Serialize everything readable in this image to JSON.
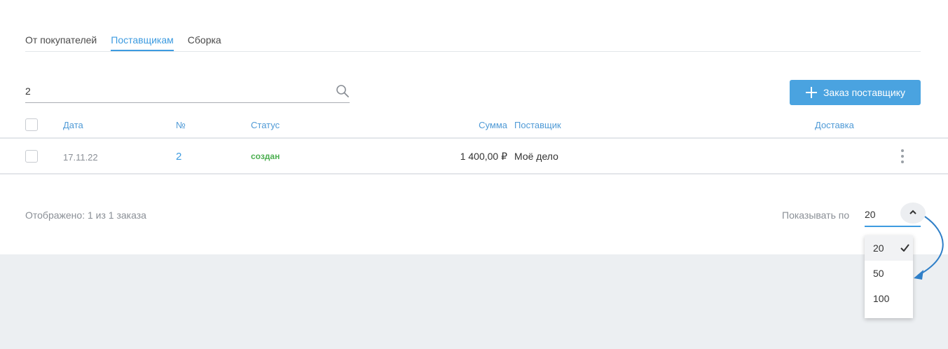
{
  "tabs": [
    {
      "label": "От покупателей",
      "active": false
    },
    {
      "label": "Поставщикам",
      "active": true
    },
    {
      "label": "Сборка",
      "active": false
    }
  ],
  "search": {
    "value": "2",
    "icon": "search-icon"
  },
  "toolbar": {
    "add_order_label": "Заказ поставщику"
  },
  "table": {
    "headers": {
      "date": "Дата",
      "number": "№",
      "status": "Статус",
      "sum": "Сумма",
      "supplier": "Поставщик",
      "delivery": "Доставка"
    },
    "rows": [
      {
        "date": "17.11.22",
        "number": "2",
        "status": "создан",
        "sum": "1 400,00 ₽",
        "supplier": "Моё дело",
        "delivery": ""
      }
    ]
  },
  "footer": {
    "summary": "Отображено: 1 из 1 заказа",
    "per_page_label": "Показывать по",
    "per_page_value": "20",
    "per_page_options": [
      "20",
      "50",
      "100"
    ]
  },
  "colors": {
    "accent": "#3d9be0",
    "status_created": "#4caf50",
    "button": "#4aa3e0",
    "page_bg": "#eceff2"
  }
}
